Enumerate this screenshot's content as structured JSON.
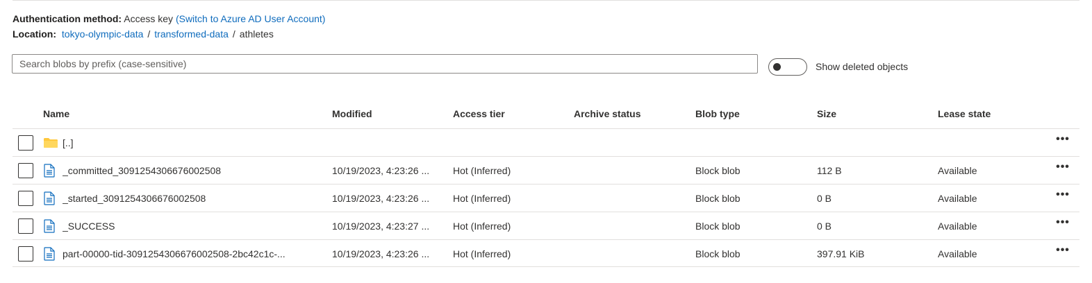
{
  "auth": {
    "label": "Authentication method:",
    "value": "Access key",
    "switch_link": "(Switch to Azure AD User Account)"
  },
  "location": {
    "label": "Location:",
    "path": [
      "tokyo-olympic-data",
      "transformed-data",
      "athletes"
    ],
    "separator": "/"
  },
  "search": {
    "placeholder": "Search blobs by prefix (case-sensitive)",
    "value": ""
  },
  "show_deleted": {
    "label": "Show deleted objects",
    "on": false
  },
  "table": {
    "columns": [
      "Name",
      "Modified",
      "Access tier",
      "Archive status",
      "Blob type",
      "Size",
      "Lease state"
    ],
    "rows": [
      {
        "icon": "folder-icon",
        "name": "[..]",
        "modified": "",
        "access_tier": "",
        "archive_status": "",
        "blob_type": "",
        "size": "",
        "lease_state": ""
      },
      {
        "icon": "file-icon",
        "name": "_committed_3091254306676002508",
        "modified": "10/19/2023, 4:23:26 ...",
        "access_tier": "Hot (Inferred)",
        "archive_status": "",
        "blob_type": "Block blob",
        "size": "112 B",
        "lease_state": "Available"
      },
      {
        "icon": "file-icon",
        "name": "_started_3091254306676002508",
        "modified": "10/19/2023, 4:23:26 ...",
        "access_tier": "Hot (Inferred)",
        "archive_status": "",
        "blob_type": "Block blob",
        "size": "0 B",
        "lease_state": "Available"
      },
      {
        "icon": "file-icon",
        "name": "_SUCCESS",
        "modified": "10/19/2023, 4:23:27 ...",
        "access_tier": "Hot (Inferred)",
        "archive_status": "",
        "blob_type": "Block blob",
        "size": "0 B",
        "lease_state": "Available"
      },
      {
        "icon": "file-icon",
        "name": "part-00000-tid-3091254306676002508-2bc42c1c-...",
        "modified": "10/19/2023, 4:23:26 ...",
        "access_tier": "Hot (Inferred)",
        "archive_status": "",
        "blob_type": "Block blob",
        "size": "397.91 KiB",
        "lease_state": "Available"
      }
    ],
    "more_label": "•••"
  },
  "colors": {
    "link": "#0f6cbd",
    "folder": "#ffc83d",
    "file_icon": "#0f6cbd",
    "border": "#e1dfdd"
  }
}
